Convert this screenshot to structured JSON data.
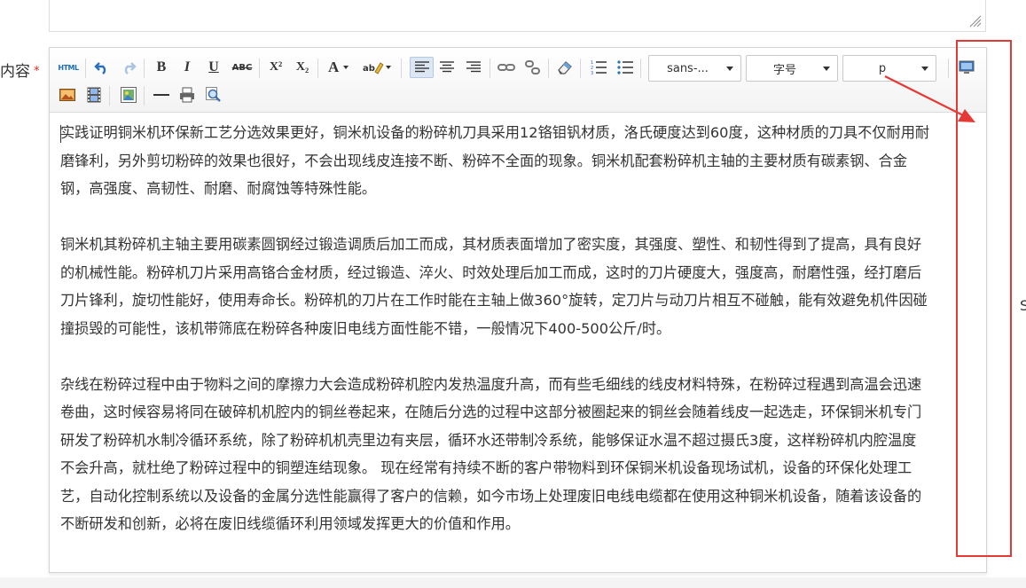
{
  "form": {
    "label": "内容",
    "required_mark": "*"
  },
  "toolbar": {
    "html_label": "HTML",
    "bold": "B",
    "italic": "I",
    "underline": "U",
    "strike": "ABC",
    "superscript": "X²",
    "subscript": "X₂",
    "font_color": "A",
    "font_family": "sans-...",
    "font_size": "字号",
    "paragraph": "p"
  },
  "content": {
    "paragraphs": [
      [
        "实践证明铜米机环保新工艺分选效果更好，铜米机设备的粉碎机刀具采用12铬钼钒材质，洛氏硬度达到60度，这种材质的刀具不仅耐用耐",
        "磨锋利，另外剪切粉碎的效果也很好，不会出现线皮连接不断、粉碎不全面的现象。铜米机配套粉碎机主轴的主要材质有碳素钢、合金",
        "钢，高强度、高韧性、耐磨、耐腐蚀等特殊性能。"
      ],
      [
        "铜米机其粉碎机主轴主要用碳素圆钢经过锻造调质后加工而成，其材质表面增加了密实度，其强度、塑性、和韧性得到了提高，具有良好",
        "的机械性能。粉碎机刀片采用高铬合金材质，经过锻造、淬火、时效处理后加工而成，这时的刀片硬度大，强度高，耐磨性强，经打磨后",
        "刀片锋利，旋切性能好，使用寿命长。粉碎机的刀片在工作时能在主轴上做360°旋转，定刀片与动刀片相互不碰触，能有效避免机件因碰",
        "撞损毁的可能性，该机带筛底在粉碎各种废旧电线方面性能不错，一般情况下400-500公斤/时。"
      ],
      [
        "杂线在粉碎过程中由于物料之间的摩擦力大会造成粉碎机腔内发热温度升高，而有些毛细线的线皮材料特殊，在粉碎过程遇到高温会迅速",
        "卷曲，这时候容易将同在破碎机机腔内的铜丝卷起来，在随后分选的过程中这部分被圈起来的铜丝会随着线皮一起选走，环保铜米机专门",
        "研发了粉碎机水制冷循环系统，除了粉碎机机壳里边有夹层，循环水还带制冷系统，能够保证水温不超过摄氏3度，这样粉碎机内腔温度",
        "不会升高，就杜绝了粉碎过程中的铜塑连结现象。 现在经常有持续不断的客户带物料到环保铜米机设备现场试机，设备的环保化处理工",
        "艺，自动化控制系统以及设备的金属分选性能赢得了客户的信赖，如今市场上处理废旧电线电缆都在使用这种铜米机设备，随着该设备的",
        "不断研发和创新，必将在废旧线缆循环利用领域发挥更大的价值和作用。"
      ]
    ]
  },
  "page_edge_char": "S",
  "colors": {
    "annotation": "#e53935",
    "required": "#d9261c",
    "active_button": "#dde7f4"
  },
  "icons": [
    "html-icon",
    "undo-icon",
    "redo-icon",
    "link-icon",
    "unlink-icon",
    "eraser-icon",
    "ordered-list-icon",
    "unordered-list-icon",
    "preview-icon",
    "image-icon",
    "video-icon",
    "gallery-icon",
    "horizontal-rule-icon",
    "print-icon",
    "search-icon"
  ]
}
